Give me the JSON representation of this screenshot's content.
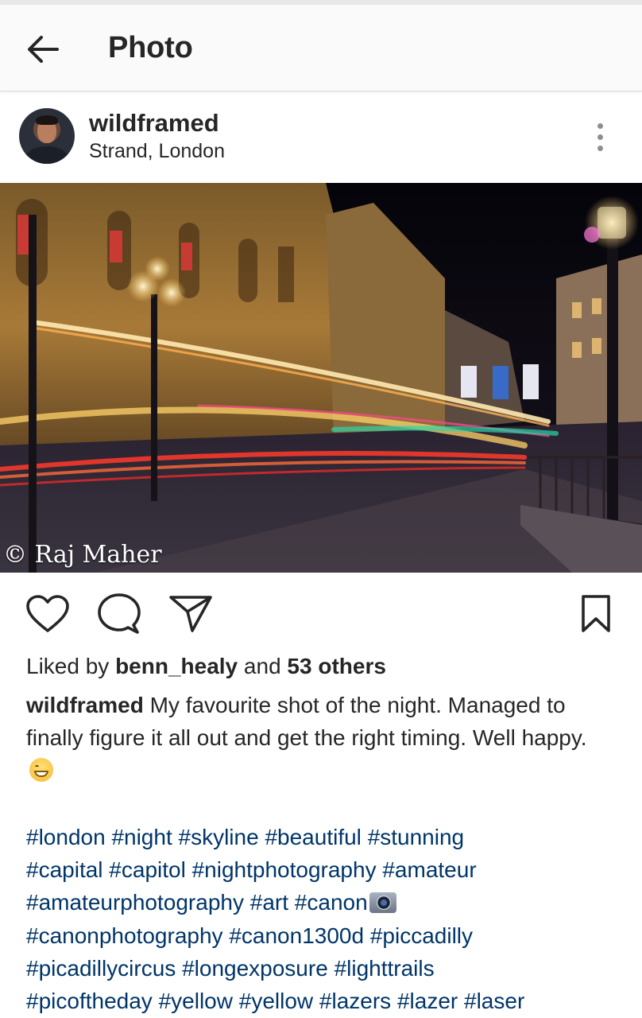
{
  "app_bar": {
    "back_icon": "arrow-left-icon",
    "title": "Photo"
  },
  "post": {
    "username": "wildframed",
    "location": "Strand, London",
    "more_icon": "more-vertical-icon",
    "photo": {
      "subject": "long-exposure night street scene with light trails",
      "watermark": "© Raj Maher"
    },
    "actions": {
      "like_icon": "heart-icon",
      "comment_icon": "comment-icon",
      "share_icon": "send-icon",
      "save_icon": "bookmark-icon"
    },
    "likes": {
      "prefix": "Liked by",
      "liker": "benn_healy",
      "connector": "and",
      "others": "53 others"
    },
    "caption": {
      "username": "wildframed",
      "text": "My favourite shot of the night. Managed to finally figure it all out and get the right timing. Well happy.",
      "emoji": "grinning-face-emoji"
    },
    "hashtags": [
      "#london",
      "#night",
      "#skyline",
      "#beautiful",
      "#stunning",
      "#capital",
      "#capitol",
      "#nightphotography",
      "#amateur",
      "#amateurphotography",
      "#art",
      "#canon",
      "#canonphotography",
      "#canon1300d",
      "#piccadilly",
      "#picadillycircus",
      "#longexposure",
      "#lighttrails",
      "#picoftheday",
      "#yellow",
      "#yellow",
      "#lazers",
      "#lazer",
      "#laser"
    ],
    "hashtag_camera_emoji": "camera-emoji"
  },
  "colors": {
    "hashtag": "#003569",
    "text": "#262626",
    "icon": "#262626",
    "appbar_bg": "#fafafa"
  }
}
